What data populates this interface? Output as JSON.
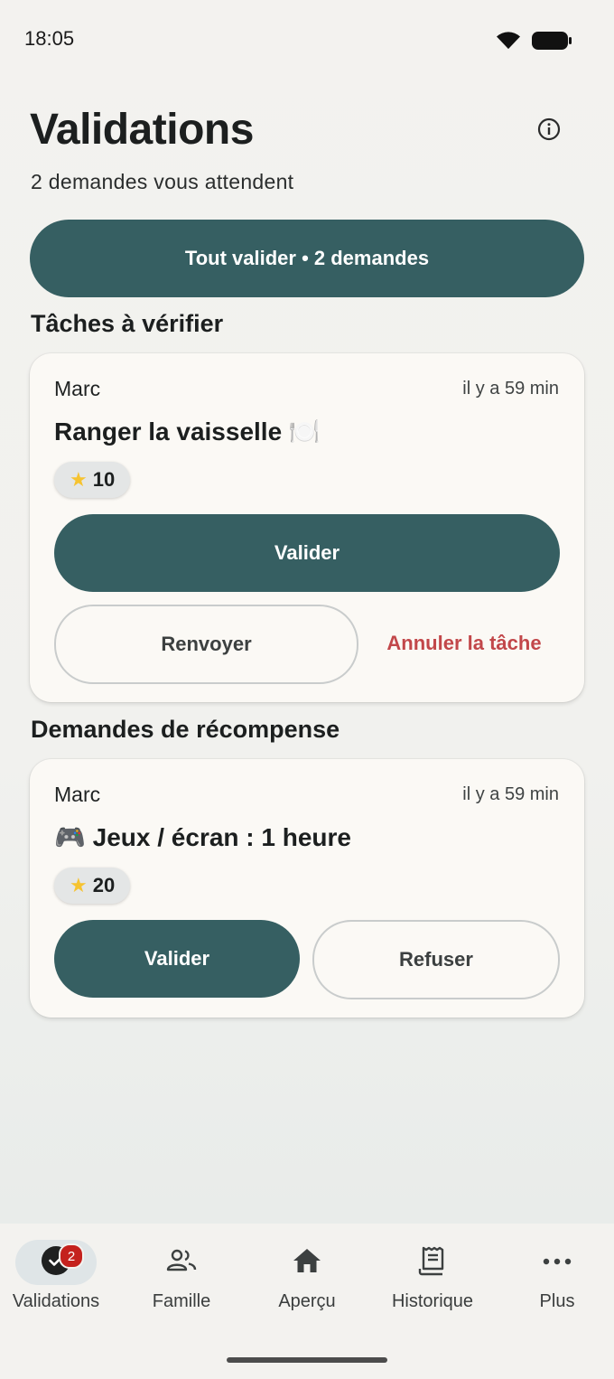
{
  "status_bar": {
    "time": "18:05",
    "icons": [
      "wifi-icon",
      "battery-icon"
    ]
  },
  "header": {
    "title": "Validations",
    "subtitle": "2 demandes vous attendent",
    "info_icon": "info-icon"
  },
  "validate_all_label": "Tout valider • 2 demandes",
  "tasks_section": {
    "title": "Tâches à vérifier",
    "card": {
      "who": "Marc",
      "time": "il y a 59 min",
      "title": "Ranger la vaisselle 🍽️",
      "points": "10",
      "validate_label": "Valider",
      "resend_label": "Renvoyer",
      "cancel_label": "Annuler la tâche"
    }
  },
  "rewards_section": {
    "title": "Demandes de récompense",
    "card": {
      "who": "Marc",
      "time": "il y a 59 min",
      "title": "🎮 Jeux / écran : 1 heure",
      "points": "20",
      "validate_label": "Valider",
      "refuse_label": "Refuser"
    }
  },
  "bottom_nav": {
    "items": [
      {
        "label": "Validations",
        "icon": "check-circle-icon",
        "badge": "2",
        "active": true
      },
      {
        "label": "Famille",
        "icon": "people-icon"
      },
      {
        "label": "Aperçu",
        "icon": "home-icon"
      },
      {
        "label": "Historique",
        "icon": "receipt-icon"
      },
      {
        "label": "Plus",
        "icon": "more-icon"
      }
    ]
  },
  "colors": {
    "primary": "#365f62",
    "danger": "#c2474a",
    "badge": "#c4211d",
    "star": "#f6c330"
  }
}
